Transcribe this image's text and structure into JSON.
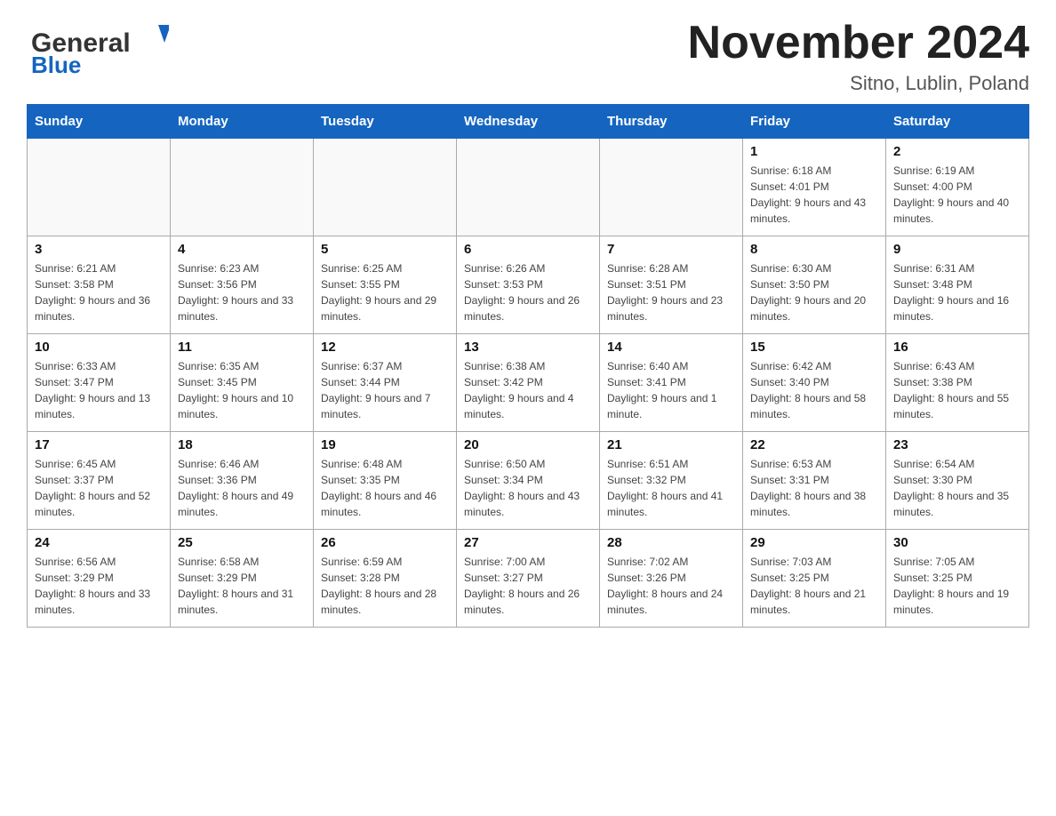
{
  "header": {
    "logo_general": "General",
    "logo_blue": "Blue",
    "month_title": "November 2024",
    "location": "Sitno, Lublin, Poland"
  },
  "days_of_week": [
    "Sunday",
    "Monday",
    "Tuesday",
    "Wednesday",
    "Thursday",
    "Friday",
    "Saturday"
  ],
  "weeks": [
    [
      {
        "day": "",
        "info": ""
      },
      {
        "day": "",
        "info": ""
      },
      {
        "day": "",
        "info": ""
      },
      {
        "day": "",
        "info": ""
      },
      {
        "day": "",
        "info": ""
      },
      {
        "day": "1",
        "info": "Sunrise: 6:18 AM\nSunset: 4:01 PM\nDaylight: 9 hours and 43 minutes."
      },
      {
        "day": "2",
        "info": "Sunrise: 6:19 AM\nSunset: 4:00 PM\nDaylight: 9 hours and 40 minutes."
      }
    ],
    [
      {
        "day": "3",
        "info": "Sunrise: 6:21 AM\nSunset: 3:58 PM\nDaylight: 9 hours and 36 minutes."
      },
      {
        "day": "4",
        "info": "Sunrise: 6:23 AM\nSunset: 3:56 PM\nDaylight: 9 hours and 33 minutes."
      },
      {
        "day": "5",
        "info": "Sunrise: 6:25 AM\nSunset: 3:55 PM\nDaylight: 9 hours and 29 minutes."
      },
      {
        "day": "6",
        "info": "Sunrise: 6:26 AM\nSunset: 3:53 PM\nDaylight: 9 hours and 26 minutes."
      },
      {
        "day": "7",
        "info": "Sunrise: 6:28 AM\nSunset: 3:51 PM\nDaylight: 9 hours and 23 minutes."
      },
      {
        "day": "8",
        "info": "Sunrise: 6:30 AM\nSunset: 3:50 PM\nDaylight: 9 hours and 20 minutes."
      },
      {
        "day": "9",
        "info": "Sunrise: 6:31 AM\nSunset: 3:48 PM\nDaylight: 9 hours and 16 minutes."
      }
    ],
    [
      {
        "day": "10",
        "info": "Sunrise: 6:33 AM\nSunset: 3:47 PM\nDaylight: 9 hours and 13 minutes."
      },
      {
        "day": "11",
        "info": "Sunrise: 6:35 AM\nSunset: 3:45 PM\nDaylight: 9 hours and 10 minutes."
      },
      {
        "day": "12",
        "info": "Sunrise: 6:37 AM\nSunset: 3:44 PM\nDaylight: 9 hours and 7 minutes."
      },
      {
        "day": "13",
        "info": "Sunrise: 6:38 AM\nSunset: 3:42 PM\nDaylight: 9 hours and 4 minutes."
      },
      {
        "day": "14",
        "info": "Sunrise: 6:40 AM\nSunset: 3:41 PM\nDaylight: 9 hours and 1 minute."
      },
      {
        "day": "15",
        "info": "Sunrise: 6:42 AM\nSunset: 3:40 PM\nDaylight: 8 hours and 58 minutes."
      },
      {
        "day": "16",
        "info": "Sunrise: 6:43 AM\nSunset: 3:38 PM\nDaylight: 8 hours and 55 minutes."
      }
    ],
    [
      {
        "day": "17",
        "info": "Sunrise: 6:45 AM\nSunset: 3:37 PM\nDaylight: 8 hours and 52 minutes."
      },
      {
        "day": "18",
        "info": "Sunrise: 6:46 AM\nSunset: 3:36 PM\nDaylight: 8 hours and 49 minutes."
      },
      {
        "day": "19",
        "info": "Sunrise: 6:48 AM\nSunset: 3:35 PM\nDaylight: 8 hours and 46 minutes."
      },
      {
        "day": "20",
        "info": "Sunrise: 6:50 AM\nSunset: 3:34 PM\nDaylight: 8 hours and 43 minutes."
      },
      {
        "day": "21",
        "info": "Sunrise: 6:51 AM\nSunset: 3:32 PM\nDaylight: 8 hours and 41 minutes."
      },
      {
        "day": "22",
        "info": "Sunrise: 6:53 AM\nSunset: 3:31 PM\nDaylight: 8 hours and 38 minutes."
      },
      {
        "day": "23",
        "info": "Sunrise: 6:54 AM\nSunset: 3:30 PM\nDaylight: 8 hours and 35 minutes."
      }
    ],
    [
      {
        "day": "24",
        "info": "Sunrise: 6:56 AM\nSunset: 3:29 PM\nDaylight: 8 hours and 33 minutes."
      },
      {
        "day": "25",
        "info": "Sunrise: 6:58 AM\nSunset: 3:29 PM\nDaylight: 8 hours and 31 minutes."
      },
      {
        "day": "26",
        "info": "Sunrise: 6:59 AM\nSunset: 3:28 PM\nDaylight: 8 hours and 28 minutes."
      },
      {
        "day": "27",
        "info": "Sunrise: 7:00 AM\nSunset: 3:27 PM\nDaylight: 8 hours and 26 minutes."
      },
      {
        "day": "28",
        "info": "Sunrise: 7:02 AM\nSunset: 3:26 PM\nDaylight: 8 hours and 24 minutes."
      },
      {
        "day": "29",
        "info": "Sunrise: 7:03 AM\nSunset: 3:25 PM\nDaylight: 8 hours and 21 minutes."
      },
      {
        "day": "30",
        "info": "Sunrise: 7:05 AM\nSunset: 3:25 PM\nDaylight: 8 hours and 19 minutes."
      }
    ]
  ]
}
